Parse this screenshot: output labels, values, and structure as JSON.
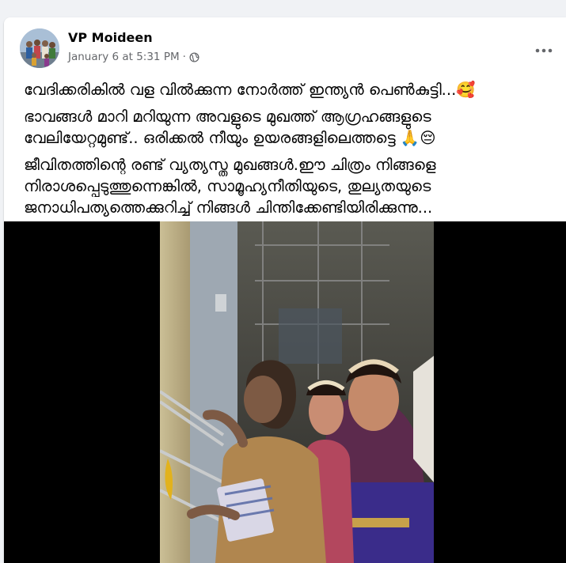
{
  "post": {
    "author": "VP Moideen",
    "timestamp": "January 6 at 5:31 PM",
    "separator": "·",
    "privacy_icon": "globe-icon",
    "more_icon": "more-options-icon",
    "lines": [
      "വേദിക്കരികിൽ വള വിൽക്കുന്ന നോർത്ത് ഇന്ത്യൻ പെൺകുട്ടി...🥰",
      "ഭാവങ്ങൾ മാറി മറിയുന്ന അവളുടെ മുഖത്ത് ആഗ്രഹങ്ങളുടെ",
      "വേലിയേറ്റമുണ്ട്.. ഒരിക്കൽ നീയും ഉയരങ്ങളിലെത്തട്ടെ 🙏😔",
      "ജീവിതത്തിന്റെ രണ്ട് വ്യത്യസ്ത മുഖങ്ങൾ.ഈ ചിത്രം നിങ്ങളെ",
      "നിരാശപ്പെടുത്തുന്നെങ്കിൽ, സാമൂഹ്യനീതിയുടെ, തുല്യതയുടെ",
      "ജനാധിപത്യത്തെക്കുറിച്ച് നിങ്ങൾ ചിന്തിക്കേണ്ടിയിരിക്കുന്നു..."
    ]
  },
  "colors": {
    "page_bg": "#f0f2f5",
    "card_bg": "#ffffff",
    "text_primary": "#050505",
    "text_secondary": "#65676b"
  }
}
